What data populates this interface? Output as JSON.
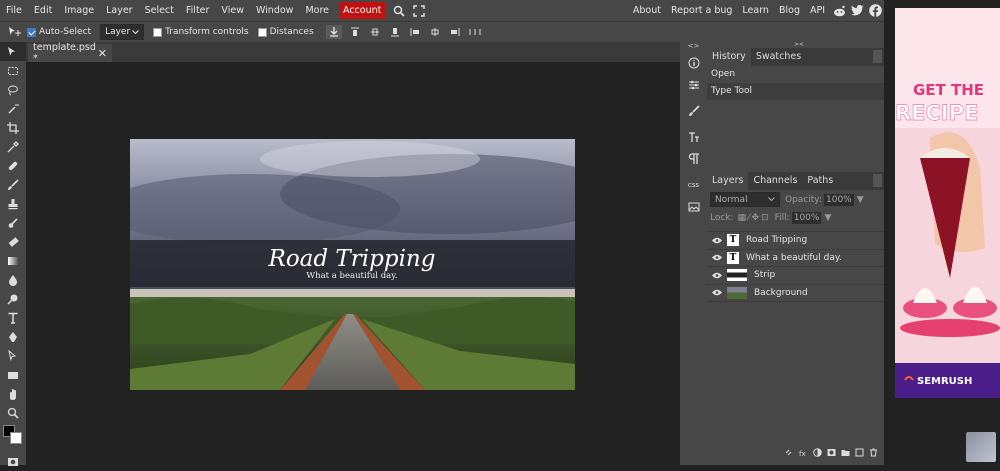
{
  "menu": {
    "items": [
      "File",
      "Edit",
      "Image",
      "Layer",
      "Select",
      "Filter",
      "View",
      "Window",
      "More"
    ],
    "account": "Account",
    "right": [
      "About",
      "Report a bug",
      "Learn",
      "Blog",
      "API"
    ]
  },
  "options": {
    "auto_select": "Auto-Select",
    "auto_select_checked": true,
    "layer_select": "Layer",
    "transform_controls": "Transform controls",
    "distances": "Distances"
  },
  "document_tab": {
    "title": "template.psd *",
    "close": "✕"
  },
  "canvas": {
    "title": "Road Tripping",
    "subtitle": "What a beautiful day."
  },
  "history_panel": {
    "tabs": [
      "History",
      "Swatches"
    ],
    "entries": [
      "Open",
      "Type Tool"
    ]
  },
  "layers_panel": {
    "tabs": [
      "Layers",
      "Channels",
      "Paths"
    ],
    "blend_mode": "Normal",
    "opacity_label": "Opacity:",
    "opacity": "100%",
    "lock_label": "Lock:",
    "fill_label": "Fill:",
    "fill": "100%",
    "layers": [
      {
        "name": "Road Tripping",
        "type": "text"
      },
      {
        "name": "What a beautiful day.",
        "type": "text"
      },
      {
        "name": "Strip",
        "type": "image"
      },
      {
        "name": "Background",
        "type": "image"
      }
    ]
  },
  "side_icons": {
    "css": "css"
  },
  "ad": {
    "headline_1": "GET THE",
    "headline_2": "RECIPE",
    "brand": "SEMRUSH"
  },
  "colors": {
    "account_red": "#c0100f",
    "panel": "#474747",
    "accent_pink": "#e0387a"
  }
}
